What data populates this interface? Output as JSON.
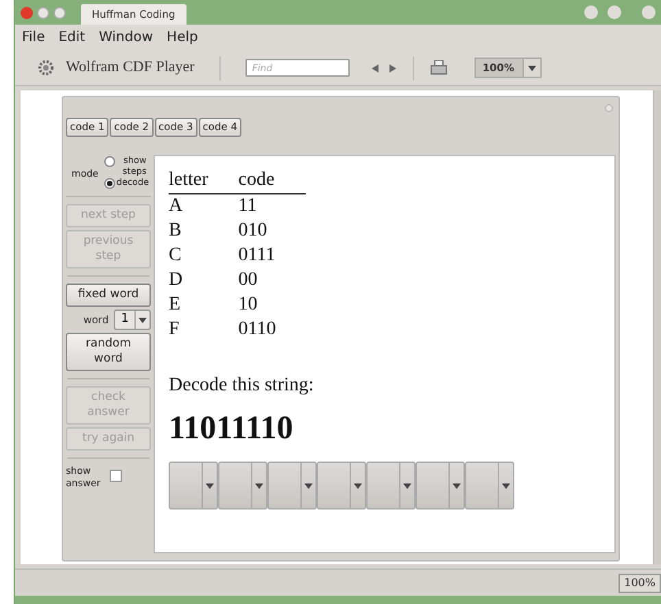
{
  "window": {
    "title": "Huffman Coding"
  },
  "menu": [
    "File",
    "Edit",
    "Window",
    "Help"
  ],
  "toolbar": {
    "brand": "Wolfram CDF Player",
    "find": {
      "placeholder": "Find"
    },
    "zoom": "100%"
  },
  "panel": {
    "tabs": [
      "code 1",
      "code 2",
      "code 3",
      "code 4"
    ],
    "mode": {
      "label": "mode",
      "options": [
        {
          "label": "show steps",
          "selected": false
        },
        {
          "label": "decode",
          "selected": true
        }
      ]
    },
    "controls": [
      {
        "kind": "button",
        "label": "next step",
        "disabled": true
      },
      {
        "kind": "button",
        "label": "previous step",
        "disabled": true
      },
      {
        "kind": "divider"
      },
      {
        "kind": "button",
        "label": "fixed word",
        "disabled": false
      },
      {
        "kind": "select",
        "label": "word",
        "value": "1"
      },
      {
        "kind": "button",
        "label": "random word",
        "disabled": false
      },
      {
        "kind": "divider"
      },
      {
        "kind": "button",
        "label": "check answer",
        "disabled": true
      },
      {
        "kind": "button",
        "label": "try again",
        "disabled": true
      },
      {
        "kind": "divider"
      },
      {
        "kind": "checkbox",
        "label": "show answer",
        "checked": false
      }
    ],
    "table": {
      "columns": [
        "letter",
        "code"
      ],
      "rows": [
        [
          "A",
          "11"
        ],
        [
          "B",
          "010"
        ],
        [
          "C",
          "0111"
        ],
        [
          "D",
          "00"
        ],
        [
          "E",
          "10"
        ],
        [
          "F",
          "0110"
        ]
      ]
    },
    "prompt": "Decode this string:",
    "string": "11011110",
    "answer_slots": [
      {
        "kind": "dropdown"
      },
      {
        "kind": "dropdown"
      },
      {
        "kind": "dropdown"
      },
      {
        "kind": "dropdown"
      },
      {
        "kind": "dropdown"
      },
      {
        "kind": "dropdown"
      },
      {
        "kind": "dropdown"
      }
    ]
  },
  "status_bar": {
    "zoom": "100%"
  }
}
